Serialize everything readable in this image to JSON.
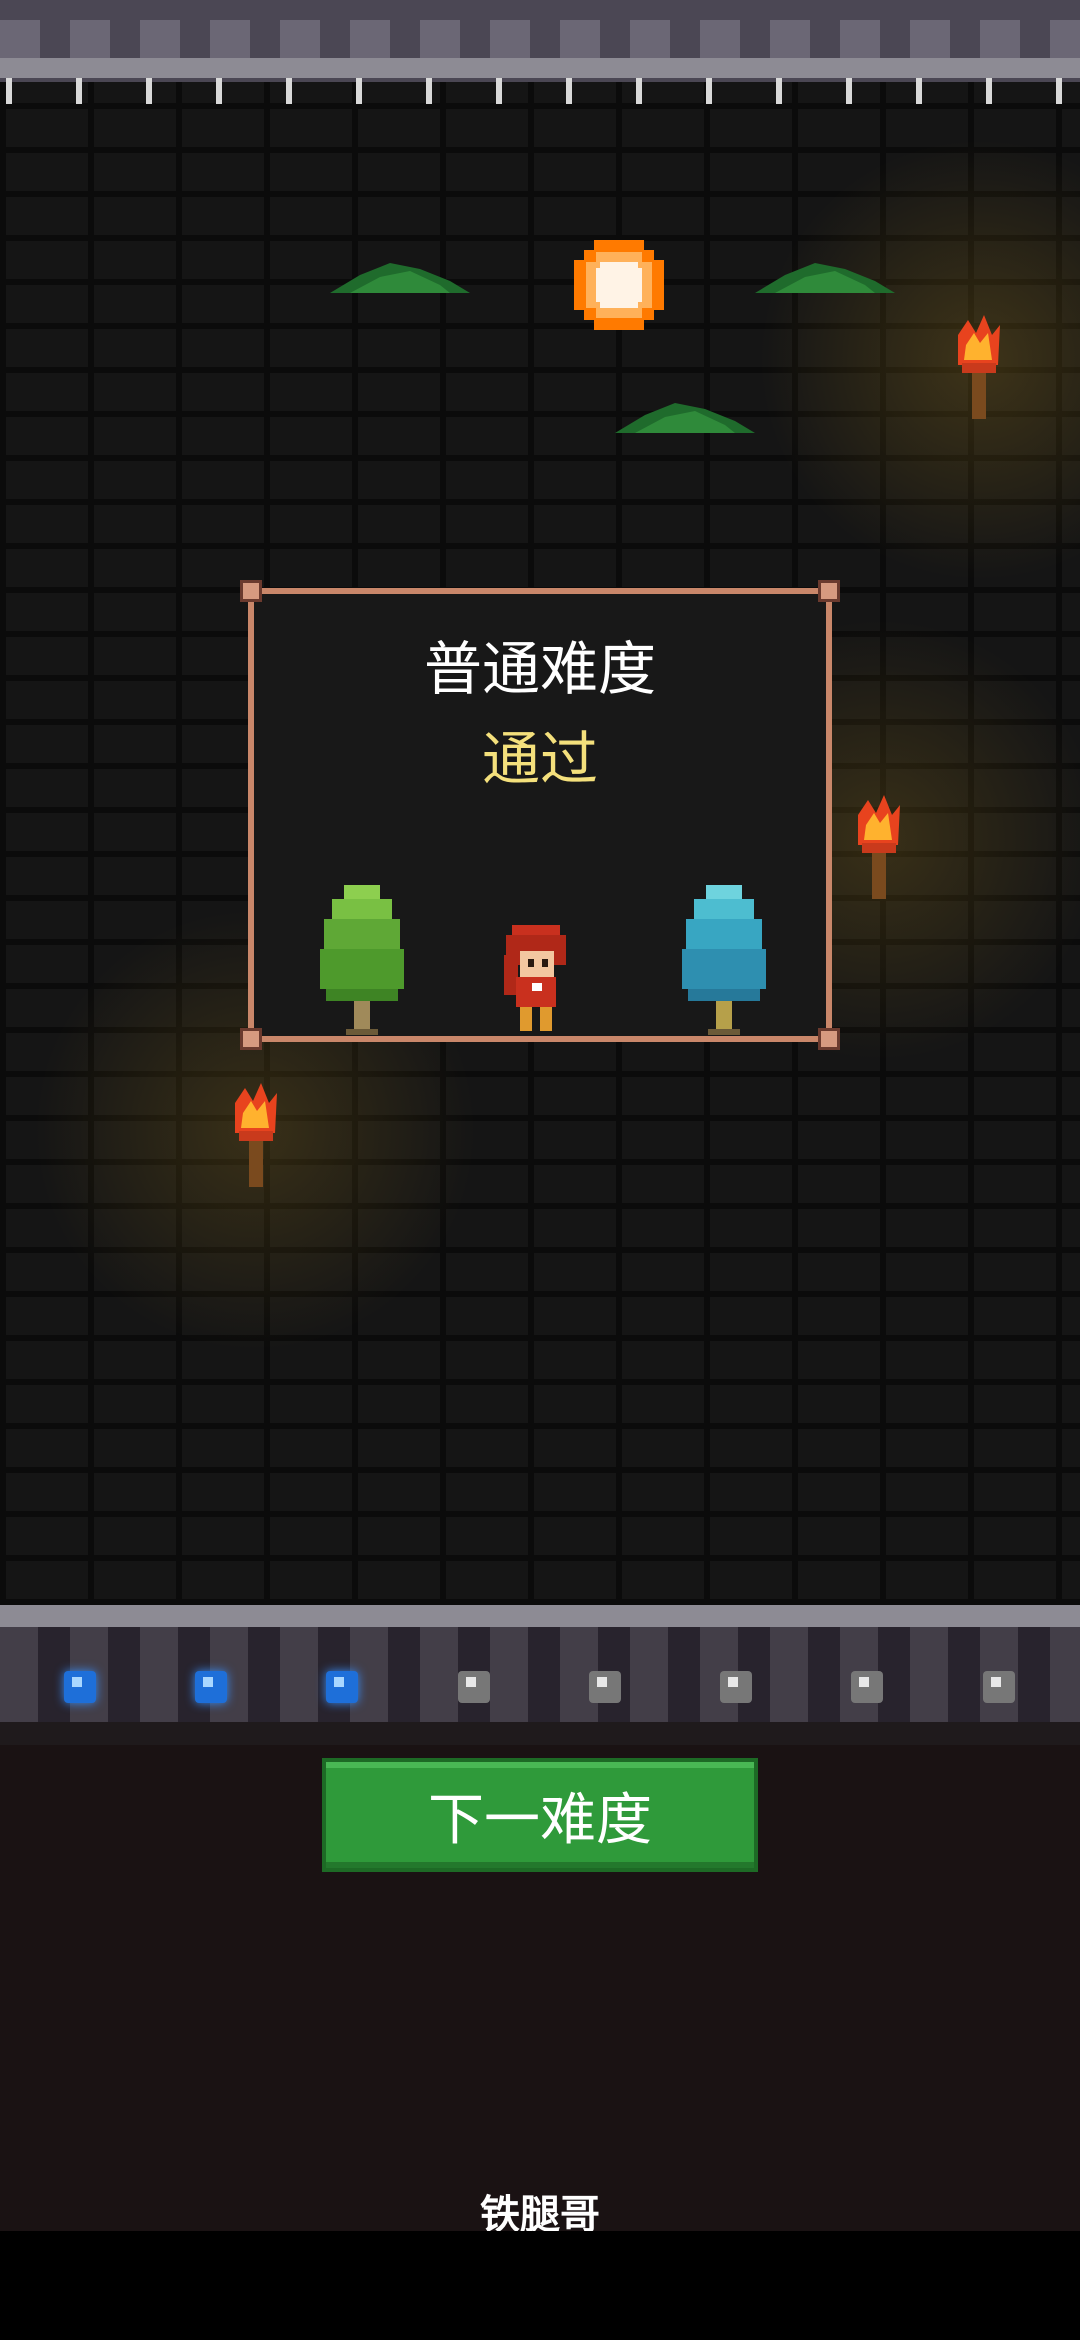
{
  "level": {
    "difficulty_title": "普通难度",
    "result": "通过"
  },
  "progress": {
    "gems": [
      {
        "state": "filled",
        "color": "#1e6fd9"
      },
      {
        "state": "filled",
        "color": "#1e6fd9"
      },
      {
        "state": "filled",
        "color": "#1e6fd9"
      },
      {
        "state": "empty",
        "color": "#777777"
      },
      {
        "state": "empty",
        "color": "#777777"
      },
      {
        "state": "empty",
        "color": "#777777"
      },
      {
        "state": "empty",
        "color": "#777777"
      },
      {
        "state": "empty",
        "color": "#777777"
      }
    ],
    "completed": 3,
    "total": 8
  },
  "actions": {
    "next_label": "下一难度"
  },
  "footer": {
    "username": "铁腿哥"
  },
  "colors": {
    "accent_green": "#2f9a3a",
    "result_yellow": "#f4e07c",
    "frame_copper": "#c9876a"
  }
}
